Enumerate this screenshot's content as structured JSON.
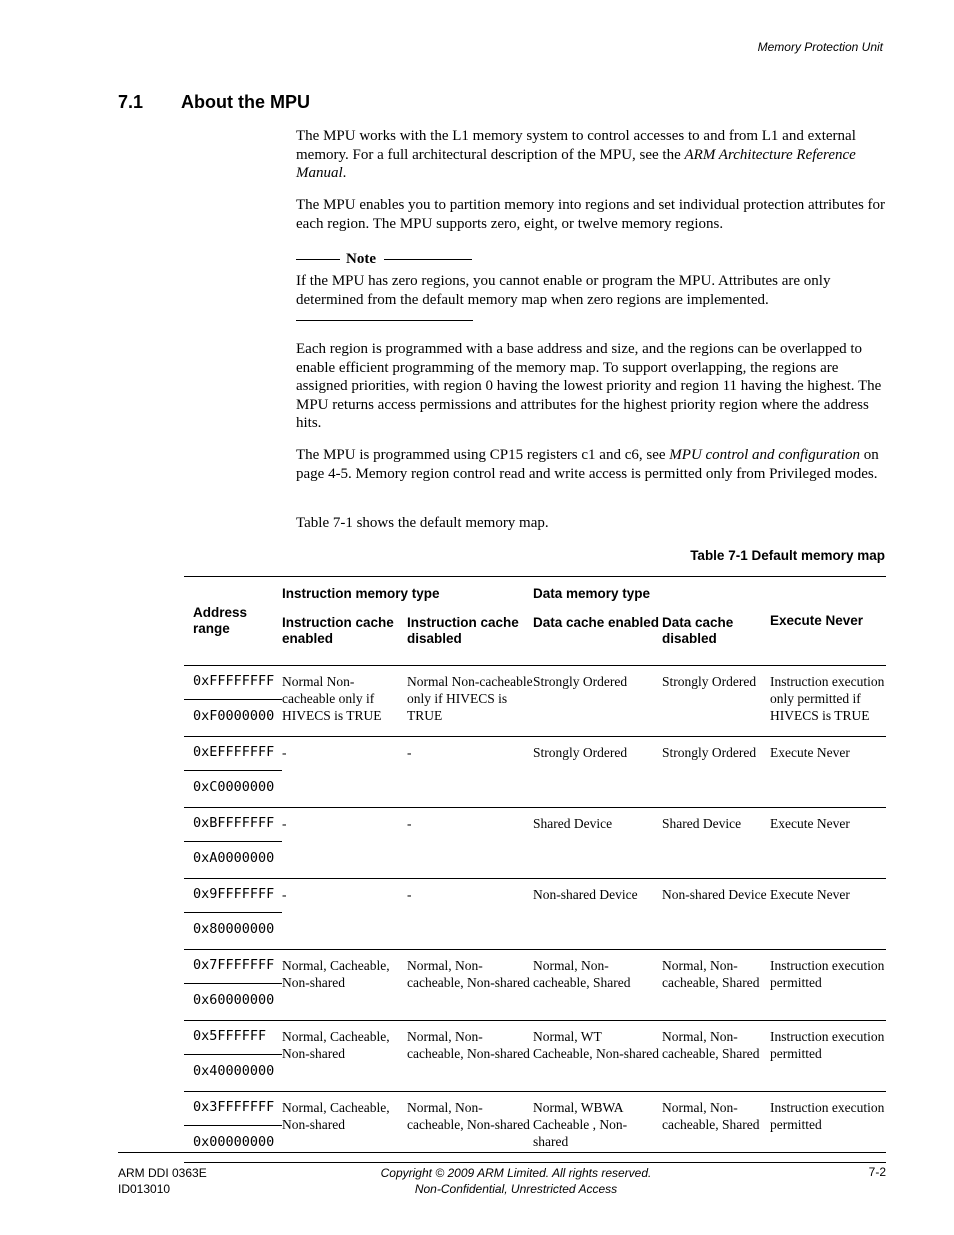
{
  "header": {
    "chapter_title": "Memory Protection Unit"
  },
  "section": {
    "number": "7.1",
    "title": "About the MPU"
  },
  "paragraphs": {
    "p1_a": "The MPU works with the L1 memory system to control accesses to and from L1 and external memory. For a full architectural description of the MPU, see the ",
    "p1_ref": "ARM Architecture Reference Manual",
    "p1_b": ".",
    "p2": "The MPU enables you to partition memory into regions and set individual protection attributes for each region. The MPU supports zero, eight, or twelve memory regions.",
    "note_label": "Note",
    "note_text": "If the MPU has zero regions, you cannot enable or program the MPU. Attributes are only determined from the default memory map when zero regions are implemented.",
    "p3": "Each region is programmed with a base address and size, and the regions can be overlapped to enable efficient programming of the memory map. To support overlapping, the regions are assigned priorities, with region 0 having the lowest priority and region 11 having the highest. The MPU returns access permissions and attributes for the highest priority region where the address hits.",
    "p4_a": "The MPU is programmed using CP15 registers c1 and c6, see ",
    "p4_ref": "MPU control and configuration",
    "p4_b": " on page 4-5. Memory region control read and write access is permitted only from Privileged modes.",
    "p5": "Table 7-1 shows the default memory map."
  },
  "table": {
    "caption": "Table 7-1 Default memory map",
    "headers": {
      "address_range": "Address range",
      "instruction_group": "Instruction memory type",
      "data_group": "Data memory type",
      "icache_enabled": "Instruction cache enabled",
      "icache_disabled": "Instruction cache disabled",
      "dcache_enabled": "Data cache enabled",
      "dcache_disabled": "Data cache disabled",
      "execute_never": "Execute Never"
    },
    "rows": [
      {
        "addr_high": "0xFFFFFFFF",
        "addr_low": "0xF0000000",
        "icache_enabled": "Normal Non-cacheable only if HIVECS is TRUE",
        "icache_disabled": "Normal Non-cacheable only if HIVECS is TRUE",
        "dcache_enabled": "Strongly Ordered",
        "dcache_disabled": "Strongly Ordered",
        "execute_never": "Instruction execution only permitted if HIVECS is TRUE"
      },
      {
        "addr_high": "0xEFFFFFFF",
        "addr_low": "0xC0000000",
        "icache_enabled": "-",
        "icache_disabled": "-",
        "dcache_enabled": "Strongly Ordered",
        "dcache_disabled": "Strongly Ordered",
        "execute_never": "Execute Never"
      },
      {
        "addr_high": "0xBFFFFFFF",
        "addr_low": "0xA0000000",
        "icache_enabled": "-",
        "icache_disabled": "-",
        "dcache_enabled": "Shared Device",
        "dcache_disabled": "Shared Device",
        "execute_never": "Execute Never"
      },
      {
        "addr_high": "0x9FFFFFFF",
        "addr_low": "0x80000000",
        "icache_enabled": "-",
        "icache_disabled": "-",
        "dcache_enabled": "Non-shared Device",
        "dcache_disabled": "Non-shared Device",
        "execute_never": "Execute Never"
      },
      {
        "addr_high": "0x7FFFFFFF",
        "addr_low": "0x60000000",
        "icache_enabled": "Normal, Cacheable, Non-shared",
        "icache_disabled": "Normal, Non-cacheable, Non-shared",
        "dcache_enabled": "Normal, Non-cacheable, Shared",
        "dcache_disabled": "Normal, Non-cacheable, Shared",
        "execute_never": "Instruction execution permitted"
      },
      {
        "addr_high": "0x5FFFFFF",
        "addr_low": "0x40000000",
        "icache_enabled": "Normal, Cacheable, Non-shared",
        "icache_disabled": "Normal, Non-cacheable, Non-shared",
        "dcache_enabled": "Normal, WT Cacheable, Non-shared",
        "dcache_disabled": "Normal, Non-cacheable, Shared",
        "execute_never": "Instruction execution permitted"
      },
      {
        "addr_high": "0x3FFFFFFF",
        "addr_low": "0x00000000",
        "icache_enabled": "Normal, Cacheable, Non-shared",
        "icache_disabled": "Normal, Non-cacheable, Non-shared",
        "dcache_enabled": "Normal, WBWA Cacheable , Non-shared",
        "dcache_disabled": "Normal, Non-cacheable, Shared",
        "execute_never": "Instruction execution permitted"
      }
    ]
  },
  "footer": {
    "doc_id": "ARM DDI 0363E",
    "doc_rev": "ID013010",
    "copyright": "Copyright © 2009 ARM Limited. All rights reserved.",
    "confidentiality": "Non-Confidential, Unrestricted Access",
    "page_number": "7-2"
  }
}
